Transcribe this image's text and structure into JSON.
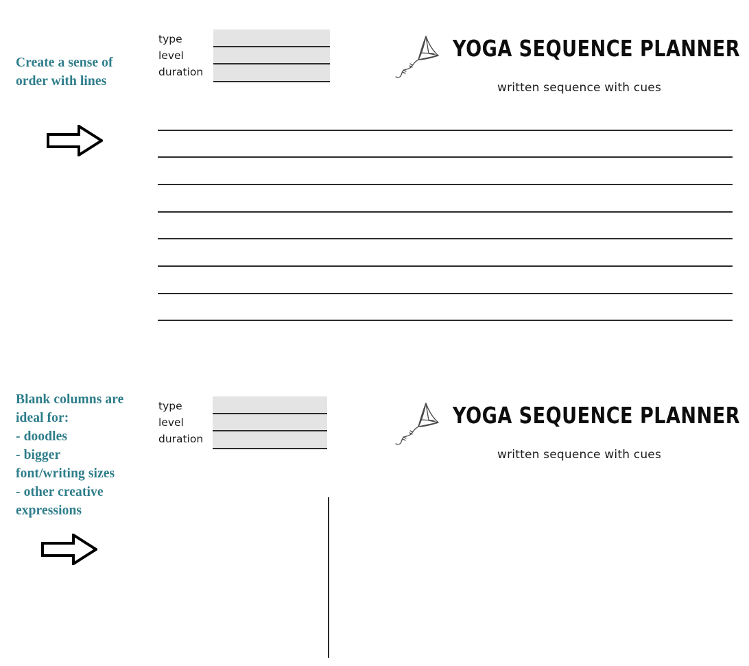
{
  "page": {
    "background": "#ffffff",
    "accent_teal": "#2E7D8A",
    "ink": "#2b2b2b",
    "field_fill": "#E4E4E4"
  },
  "blocks": [
    {
      "id": "lined-variant",
      "annotation": "Create a sense of\norder with lines",
      "annotation_lines": [
        "Create a sense of",
        "order with lines"
      ],
      "arrow_icon": "arrow-right-outline",
      "form": {
        "labels": [
          "type",
          "level",
          "duration"
        ],
        "values": [
          "",
          "",
          ""
        ]
      },
      "header": {
        "logo_icon": "kite-icon",
        "title": "YOGA SEQUENCE PLANNER",
        "subtitle": "written sequence with cues"
      },
      "body": {
        "kind": "ruled-lines",
        "line_count": 8
      }
    },
    {
      "id": "blank-column-variant",
      "annotation": "Blank columns are ideal for: - doodles - bigger font/writing sizes - other creative expressions",
      "annotation_lines": [
        "Blank columns are",
        "ideal for:",
        "- doodles",
        "- bigger",
        "font/writing sizes",
        "- other creative",
        "expressions"
      ],
      "arrow_icon": "arrow-right-outline",
      "form": {
        "labels": [
          "type",
          "level",
          "duration"
        ],
        "values": [
          "",
          "",
          ""
        ]
      },
      "header": {
        "logo_icon": "kite-icon",
        "title": "YOGA SEQUENCE PLANNER",
        "subtitle": "written sequence with cues"
      },
      "body": {
        "kind": "blank-column-divider",
        "line_count": 1
      }
    }
  ]
}
